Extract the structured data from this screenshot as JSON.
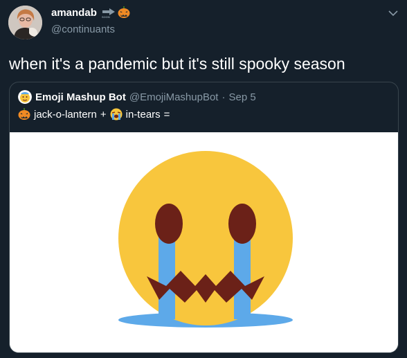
{
  "tweet": {
    "author_name": "amandab",
    "author_handle": "@continuants",
    "text": "when it's a pandemic but it's still spooky season"
  },
  "quoted_tweet": {
    "author_name": "Emoji Mashup Bot",
    "author_handle": "@EmojiMashupBot",
    "separator": "·",
    "date": "Sep 5",
    "first_emoji_name": "jack-o-lantern",
    "plus": "+",
    "second_emoji_name": "in-tears",
    "equals": "="
  },
  "colors": {
    "background": "#15202b",
    "border": "#38444d",
    "secondary_text": "#8899a6",
    "emoji_face": "#f8c63d",
    "emoji_features": "#6b2118",
    "tears": "#5da9e9",
    "pumpkin": "#f08a24"
  },
  "icons": {
    "caret": "chevron-down-icon",
    "name_arrow": "right-arrow-emoji-icon",
    "name_pumpkin": "jack-o-lantern-emoji-icon",
    "bot_avatar": "emoji-bot-avatar-icon",
    "pumpkin": "jack-o-lantern-emoji-icon",
    "crying": "loudly-crying-face-emoji-icon",
    "mashup": "crying-jack-o-lantern-mashup-image"
  }
}
